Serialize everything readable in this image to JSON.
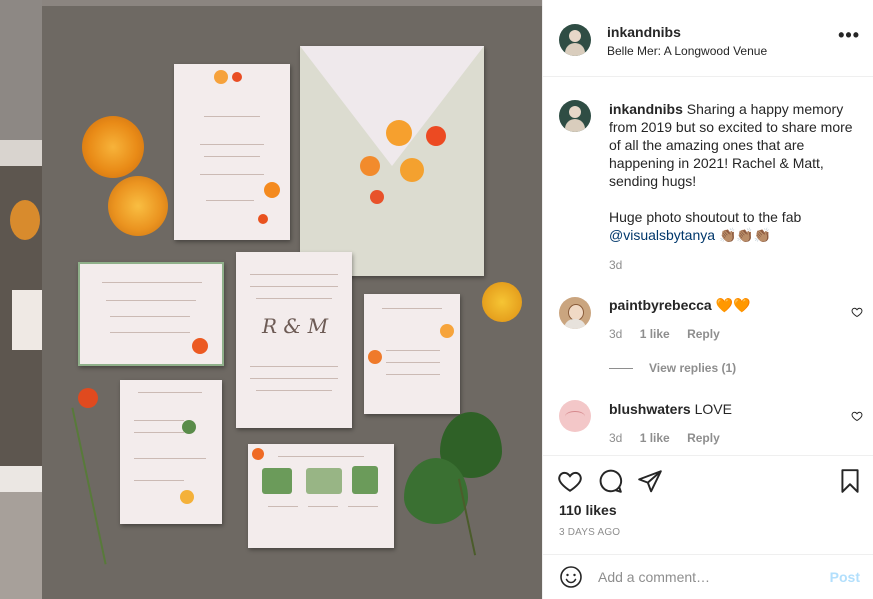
{
  "post": {
    "username": "inkandnibs",
    "location": "Belle Mer: A Longwood Venue",
    "more_label": "•••",
    "caption": {
      "username": "inkandnibs",
      "text": "Sharing a happy memory from 2019 but so excited to share more of all the amazing ones that are happening in 2021! Rachel & Matt, sending hugs!",
      "text2_prefix": "Huge photo shoutout to the fab",
      "mention": "@visualsbytanya",
      "emoji": "👏🏽👏🏽👏🏽",
      "time": "3d"
    },
    "comments": [
      {
        "username": "paintbyrebecca",
        "text": "🧡🧡",
        "time": "3d",
        "likes": "1 like",
        "reply": "Reply",
        "view_replies": "View replies (1)"
      },
      {
        "username": "blushwaters",
        "text": "LOVE",
        "time": "3d",
        "likes": "1 like",
        "reply": "Reply"
      }
    ],
    "likes_count": "110 likes",
    "date": "3 DAYS AGO",
    "add_comment_placeholder": "Add a comment…",
    "post_button": "Post"
  },
  "colors": {
    "accent": "#0095f6",
    "post_disabled": "#b2dffc",
    "link": "#00376b",
    "secondary_text": "#8e8e8e",
    "heart_orange": "#f6851b"
  },
  "icons": {
    "like": "heart-icon",
    "comment": "comment-bubble-icon",
    "share": "paper-plane-icon",
    "save": "bookmark-icon",
    "emoji": "smiley-icon",
    "comment_like": "small-heart-icon"
  }
}
